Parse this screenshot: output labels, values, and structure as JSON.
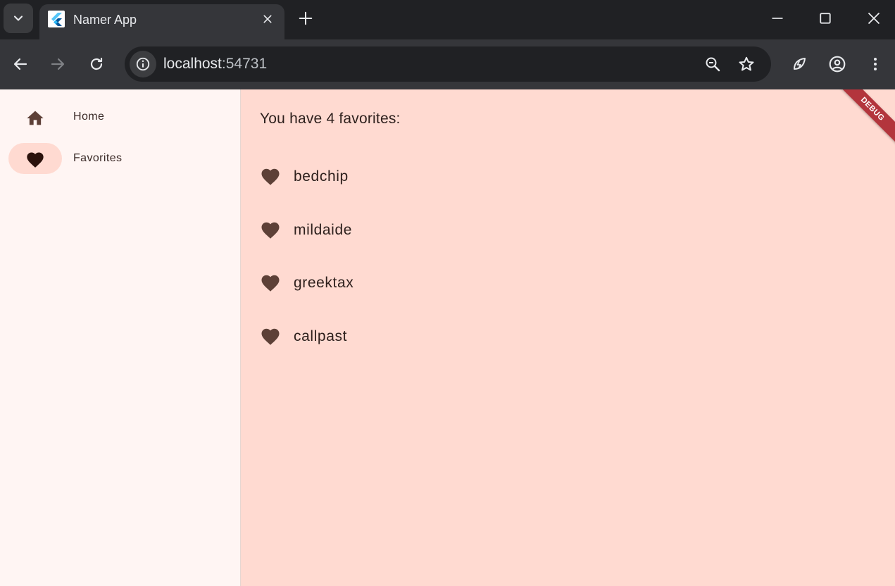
{
  "browser": {
    "tab": {
      "title": "Namer App"
    },
    "url": {
      "host": "localhost",
      "port": ":54731"
    },
    "colors": {
      "frame": "#202124",
      "toolbar": "#35363a",
      "text": "#e8eaed"
    }
  },
  "app": {
    "nav": {
      "items": [
        {
          "label": "Home",
          "icon": "home-icon",
          "selected": false
        },
        {
          "label": "Favorites",
          "icon": "favorite-heart-icon",
          "selected": true
        }
      ]
    },
    "favorites": {
      "header": "You have 4 favorites:",
      "items": [
        "bedchip",
        "mildaide",
        "greektax",
        "callpast"
      ]
    },
    "debug_banner": "DEBUG",
    "colors": {
      "rail_bg": "#fff5f3",
      "content_bg": "#ffdad1",
      "indicator": "#ffdad1",
      "heart": "#5d4037",
      "text": "#2e201d"
    }
  }
}
